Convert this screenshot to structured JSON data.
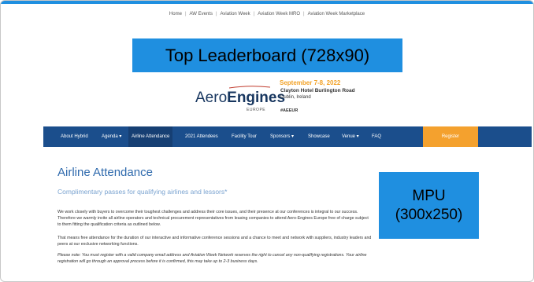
{
  "utility_nav": {
    "items": [
      "Home",
      "AW Events",
      "Aviation Week",
      "Aviation Week MRO",
      "Aviation Week Marketplace"
    ],
    "separator": "|"
  },
  "ads": {
    "leaderboard_label": "Top Leaderboard (728x90)",
    "mpu_line1": "MPU",
    "mpu_line2": "(300x250)"
  },
  "logo": {
    "text_plain": "Aero",
    "text_bold": "Engines",
    "subtitle": "EUROPE"
  },
  "event": {
    "date": "September 7-8, 2022",
    "venue": "Clayton Hotel Burlington Road",
    "city": "Dublin, Ireland",
    "hashtag": "#AEEUR"
  },
  "main_nav": {
    "items": [
      "About Hybrid",
      "Agenda ▾",
      "Airline Attendance",
      "2021 Attendees",
      "Facility Tour",
      "Sponsors ▾",
      "Showcase",
      "Venue ▾",
      "FAQ"
    ],
    "active_index": 2,
    "register_label": "Register"
  },
  "content": {
    "title": "Airline Attendance",
    "subheading": "Complimentary passes for qualifying airlines and lessors*",
    "paragraph1": "We work closely with buyers to overcome their toughest challenges and address their core issues, and their presence at our conferences is integral to our success. Therefore we warmly invite all airline operators and technical procurement representatives from leasing companies to attend Aero-Engines Europe free of charge subject to them fitting the qualification criteria as outlined below.",
    "paragraph2": "That means free attendance for the duration of our interactive and informative conference sessions and a chance to meet and network with suppliers, industry leaders and peers at our exclusive networking functions.",
    "paragraph3": "Please note: You must register with a valid company email address and Aviation Week Network reserves the right to cancel any non-qualifying registrations. Your airline registration will go through an approval process before it is confirmed, this may take up to 2-3 business days."
  },
  "colors": {
    "accent_blue": "#1f8fe0",
    "nav_blue": "#1b4e8c",
    "register_orange": "#f4a12e",
    "title_blue": "#2f6aad"
  }
}
